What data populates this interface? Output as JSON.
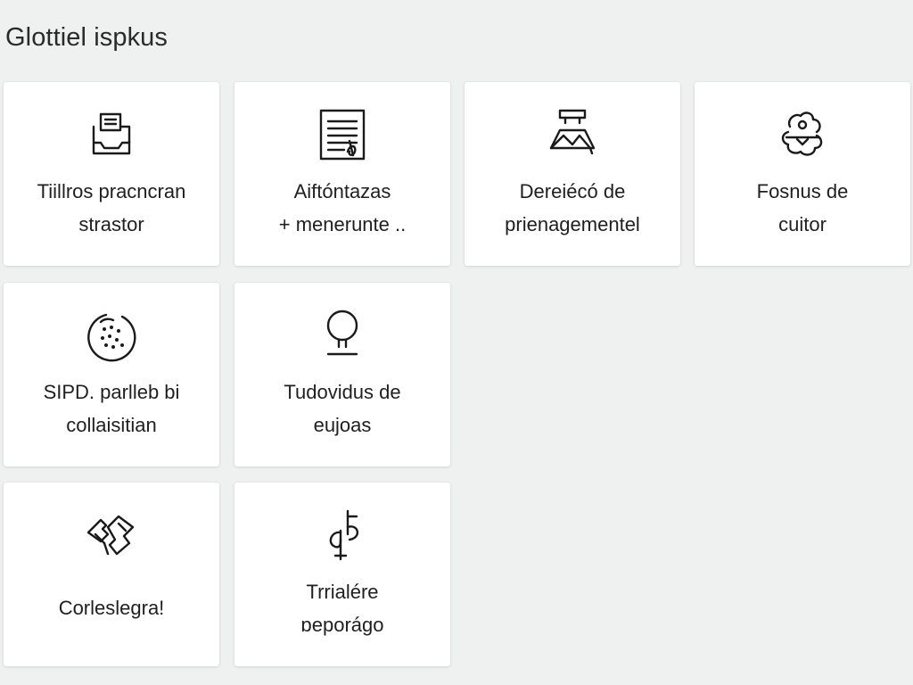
{
  "page": {
    "title": "Glottiel ispkus"
  },
  "tiles": [
    {
      "icon": "printer-tray-icon",
      "line1": "Tiillros pracncran",
      "line2": "strastor"
    },
    {
      "icon": "document-signature-icon",
      "line1": "Aiftóntazas",
      "line2": "+ menerunte .."
    },
    {
      "icon": "mountain-frame-icon",
      "line1": "Dereiécó de",
      "line2": "prienagementel"
    },
    {
      "icon": "cloud-gear-icon",
      "line1": "Fosnus de",
      "line2": "cuitor"
    },
    {
      "icon": "dotted-circle-icon",
      "line1": "SIPD. parlleb bi",
      "line2": "collaisitian"
    },
    {
      "icon": "pin-location-icon",
      "line1": "Tudovidus de",
      "line2": "eujoas"
    },
    {
      "icon": "broken-tag-icon",
      "line1": "Corleslegra!",
      "line2": ""
    },
    {
      "icon": "hook-plus-icon",
      "line1": "Trrialére",
      "line2": "ɒeporágo"
    }
  ]
}
